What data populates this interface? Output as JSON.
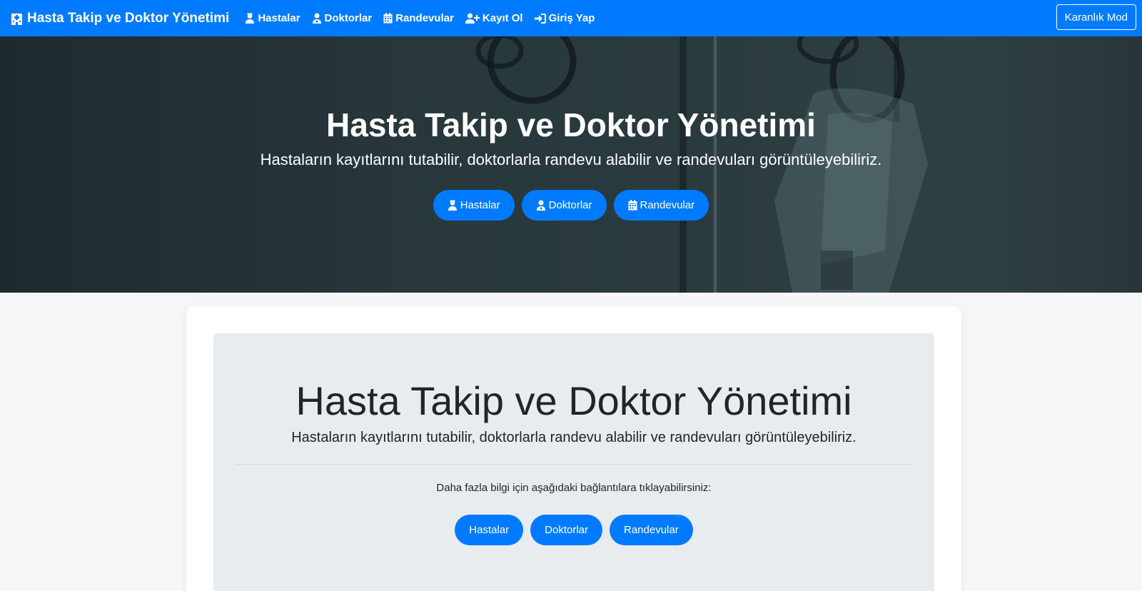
{
  "navbar": {
    "brand": "Hasta Takip ve Doktor Yönetimi",
    "links": [
      {
        "label": "Hastalar",
        "icon": "user-nurse-icon"
      },
      {
        "label": "Doktorlar",
        "icon": "user-doctor-icon"
      },
      {
        "label": "Randevular",
        "icon": "calendar-icon"
      },
      {
        "label": "Kayıt Ol",
        "icon": "user-plus-icon"
      },
      {
        "label": "Giriş Yap",
        "icon": "sign-in-icon"
      }
    ],
    "dark_mode_label": "Karanlık Mod"
  },
  "hero": {
    "title": "Hasta Takip ve Doktor Yönetimi",
    "subtitle": "Hastaların kayıtlarını tutabilir, doktorlarla randevu alabilir ve randevuları görüntüleyebiliriz.",
    "buttons": [
      {
        "label": "Hastalar",
        "icon": "user-nurse-icon"
      },
      {
        "label": "Doktorlar",
        "icon": "user-doctor-icon"
      },
      {
        "label": "Randevular",
        "icon": "calendar-icon"
      }
    ]
  },
  "jumbotron": {
    "title": "Hasta Takip ve Doktor Yönetimi",
    "subtitle": "Hastaların kayıtlarını tutabilir, doktorlarla randevu alabilir ve randevuları görüntüleyebiliriz.",
    "info_text": "Daha fazla bilgi için aşağıdaki bağlantılara tıklayabilirsiniz:",
    "buttons": [
      {
        "label": "Hastalar"
      },
      {
        "label": "Doktorlar"
      },
      {
        "label": "Randevular"
      }
    ]
  },
  "colors": {
    "primary": "#007bff",
    "hero_overlay": "#2a3a3e",
    "jumbotron_bg": "#e9ecef",
    "page_bg": "#f4f6f8"
  }
}
